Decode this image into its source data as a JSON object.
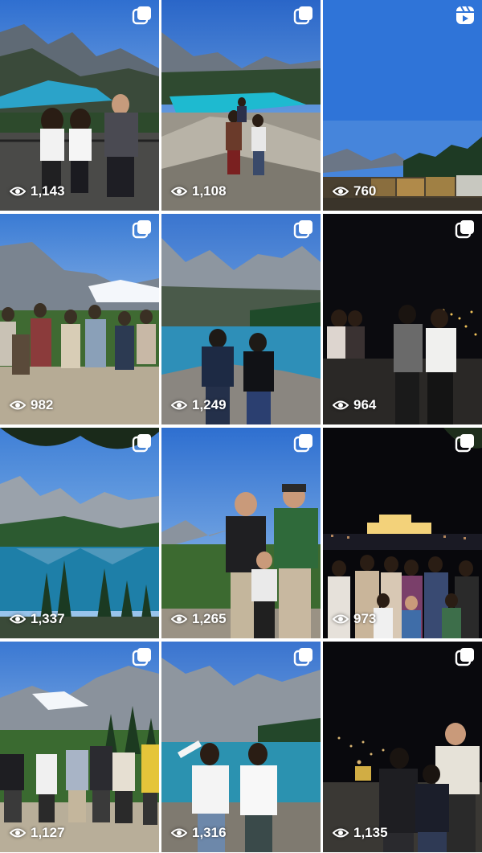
{
  "grid": {
    "tiles": [
      {
        "views": "1,143",
        "type": "carousel",
        "scene": "lake-day"
      },
      {
        "views": "1,108",
        "type": "carousel",
        "scene": "lake-rocks"
      },
      {
        "views": "760",
        "type": "reel",
        "scene": "train"
      },
      {
        "views": "982",
        "type": "carousel",
        "scene": "glacier-group"
      },
      {
        "views": "1,249",
        "type": "carousel",
        "scene": "lake-couple"
      },
      {
        "views": "964",
        "type": "carousel",
        "scene": "night"
      },
      {
        "views": "1,337",
        "type": "carousel",
        "scene": "reflection"
      },
      {
        "views": "1,265",
        "type": "carousel",
        "scene": "family-day"
      },
      {
        "views": "973",
        "type": "carousel",
        "scene": "night-group"
      },
      {
        "views": "1,127",
        "type": "carousel",
        "scene": "glacier-jump"
      },
      {
        "views": "1,316",
        "type": "carousel",
        "scene": "lake-girls"
      },
      {
        "views": "1,135",
        "type": "carousel",
        "scene": "night-family"
      }
    ]
  },
  "colors": {
    "sky": "#3f7fd6",
    "lake": "#1fa3b6",
    "night": "#0b0b0f"
  }
}
